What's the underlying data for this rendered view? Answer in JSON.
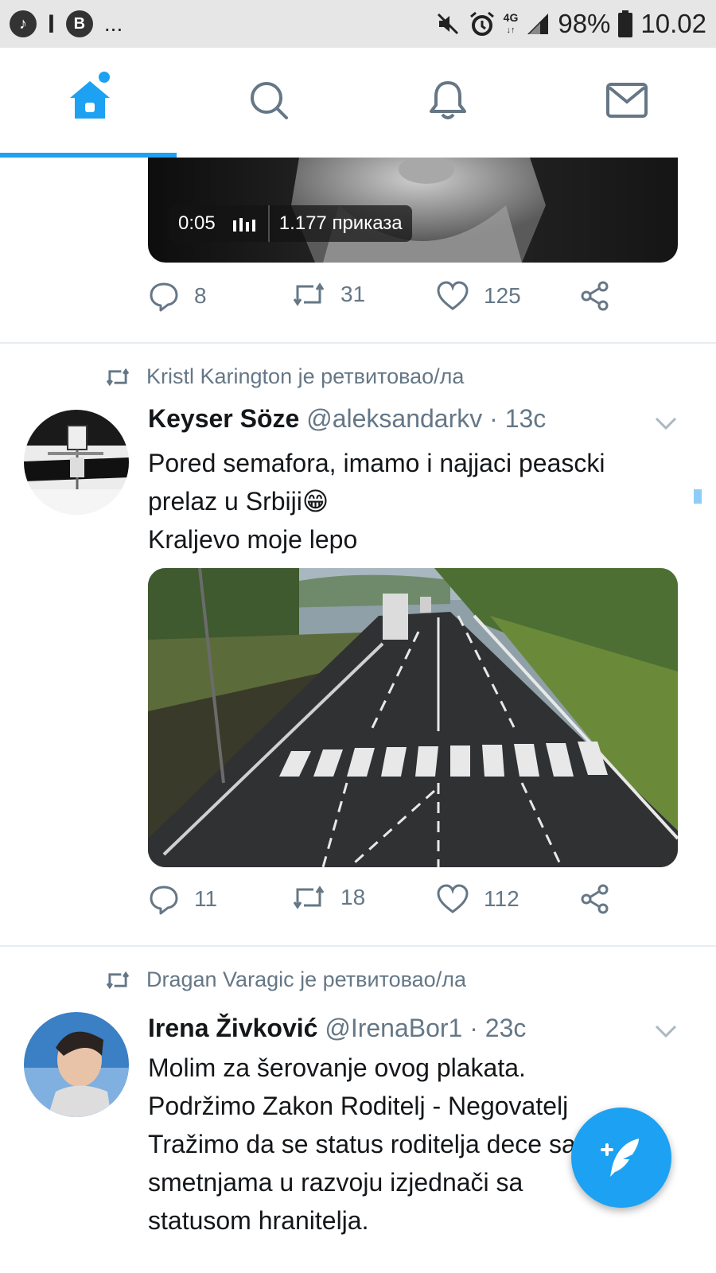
{
  "status_bar": {
    "left_icons": [
      "app-icon",
      "I",
      "B",
      "..."
    ],
    "network": "4G",
    "battery": "98%",
    "time": "10.02"
  },
  "tabs": [
    {
      "name": "home",
      "icon": "home-icon",
      "active": true,
      "has_badge": true
    },
    {
      "name": "search",
      "icon": "search-icon",
      "active": false
    },
    {
      "name": "notifications",
      "icon": "bell-icon",
      "active": false
    },
    {
      "name": "messages",
      "icon": "mail-icon",
      "active": false
    }
  ],
  "tweets": [
    {
      "video": {
        "duration": "0:05",
        "views": "1.177 приказа"
      },
      "actions": {
        "replies": "8",
        "retweets": "31",
        "likes": "125"
      }
    },
    {
      "retweeted_by": "Kristl Karington je ретвитовао/ла",
      "name": "Keyser Söze",
      "handle": "@aleksandarkv",
      "time": "· 13с",
      "text_line1": "Pored semafora, imamo i najjaci peascki",
      "text_line2": "prelaz u Srbiji",
      "emoji": "😁",
      "text_line3": "Kraljevo moje lepo",
      "actions": {
        "replies": "11",
        "retweets": "18",
        "likes": "112"
      }
    },
    {
      "retweeted_by": "Dragan Varagic je ретвитовао/ла",
      "name": "Irena Živković",
      "handle": "@IrenaBor1",
      "time": "· 23с",
      "text_lines": [
        "Molim za šerovanje ovog plakata.",
        "Podržimo Zakon Roditelj - Negovatelj",
        "Tražimo da se status roditelja dece sa",
        "smetnjama u razvoju izjednači sa",
        "statusom hranitelja."
      ]
    }
  ],
  "colors": {
    "accent": "#1da1f2",
    "secondary_text": "#657786",
    "divider": "#e6ecf0"
  }
}
